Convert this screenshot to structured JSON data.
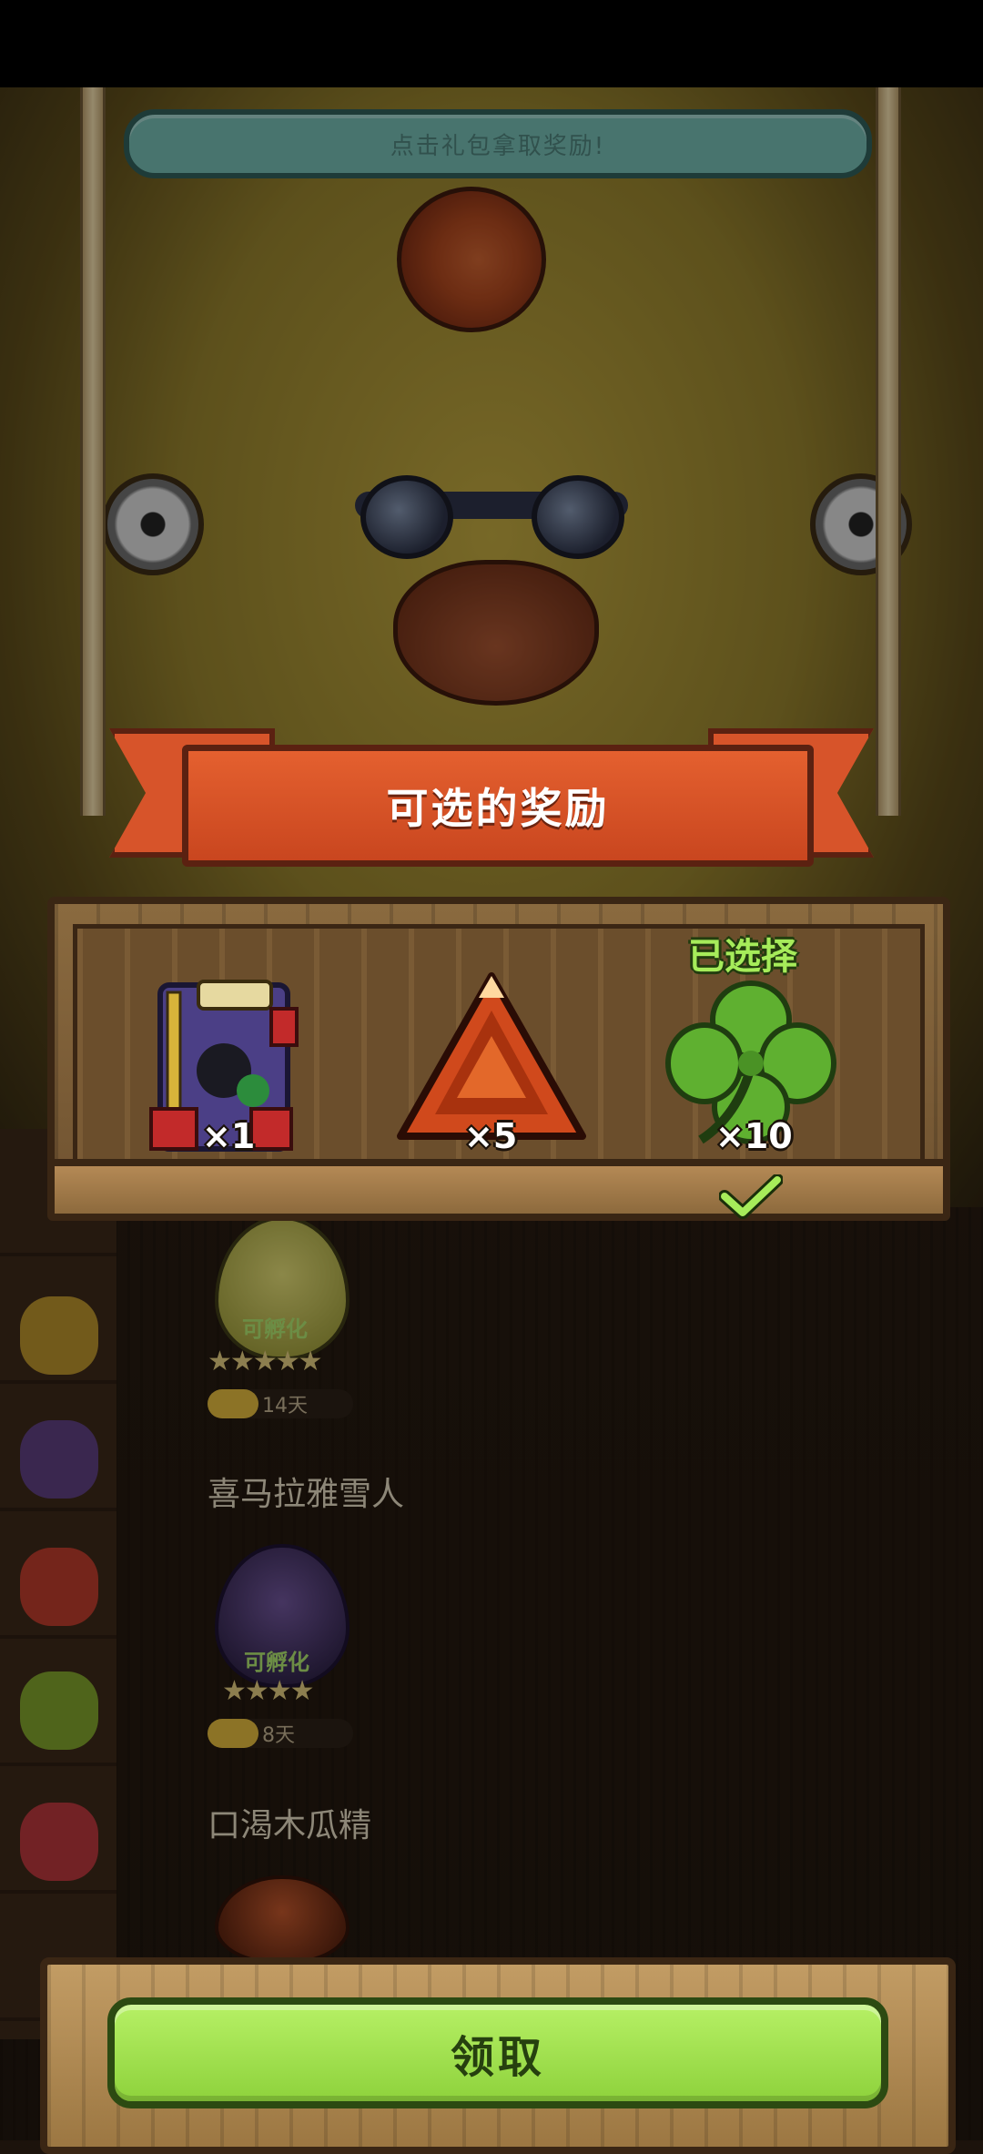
{
  "hint": {
    "text": "点击礼包拿取奖励!"
  },
  "dialog": {
    "title": "可选的奖励",
    "selected_label": "已选择",
    "rewards": [
      {
        "name": "gift-pack",
        "qty": "×1"
      },
      {
        "name": "red-gem",
        "qty": "×5"
      },
      {
        "name": "clover",
        "qty": "×10",
        "selected": true
      }
    ],
    "claim_label": "领取"
  },
  "background_list": {
    "items": [
      {
        "name": "",
        "hatch": "可孵化",
        "stars": "★★★★★",
        "days": "14天",
        "egg_color": "#b5b25a"
      },
      {
        "name": "喜马拉雅雪人",
        "hatch": "可孵化",
        "stars": "★★★★",
        "days": "8天",
        "egg_color": "#4a3a6e"
      },
      {
        "name": "口渴木瓜精",
        "egg_color": "#7a3218"
      }
    ]
  },
  "colors": {
    "accent_green": "#a6ec5a",
    "banner_red": "#d7542a",
    "wood": "#8a6a3f"
  }
}
